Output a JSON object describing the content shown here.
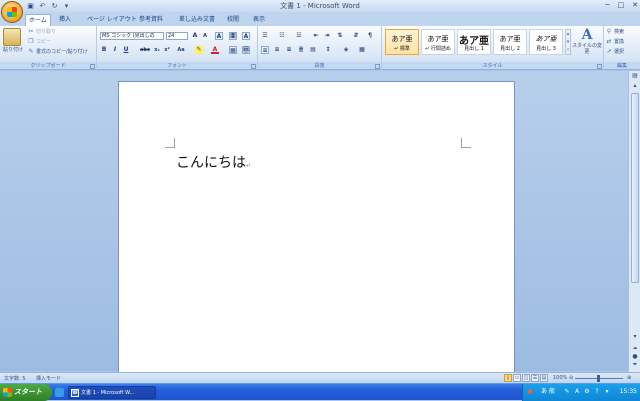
{
  "window": {
    "title": "文書 1 - Microsoft Word",
    "controls": [
      "─",
      "□",
      "✕"
    ]
  },
  "qat": {
    "icons": [
      "save-icon",
      "undo-icon",
      "redo-icon",
      "customize-icon"
    ]
  },
  "tabs": [
    "ホーム",
    "挿入",
    "ページ レイアウト",
    "参考資料",
    "差し込み文書",
    "校閲",
    "表示"
  ],
  "active_tab": "ホーム",
  "clipboard": {
    "paste": "貼り付け",
    "cut": "切り取り",
    "copy": "コピー",
    "format_painter": "書式のコピー/貼り付け",
    "label": "クリップボード"
  },
  "font": {
    "name": "MS ゴシック (見出しの",
    "size": "24",
    "label": "フォント",
    "buttons": {
      "bold": "B",
      "italic": "I",
      "underline": "U",
      "strike": "abc",
      "subscript": "x₂",
      "superscript": "x²",
      "case": "Aa",
      "grow": "A",
      "shrink": "A",
      "clear": "A",
      "phonetic": "亜",
      "border": "A"
    }
  },
  "paragraph": {
    "label": "段落"
  },
  "styles": {
    "label": "スタイル",
    "items": [
      {
        "sample": "あア亜",
        "name": "↵ 標準",
        "selected": true
      },
      {
        "sample": "あア亜",
        "name": "↵ 行間詰め",
        "selected": false
      },
      {
        "sample": "あア亜",
        "name": "見出し 1",
        "selected": false
      },
      {
        "sample": "あア亜",
        "name": "見出し 2",
        "selected": false
      },
      {
        "sample": "あア亜",
        "name": "見出し 3",
        "selected": false
      }
    ],
    "change_label": "スタイルの変更"
  },
  "editing": {
    "label": "編集",
    "find": "検索",
    "replace": "置換",
    "select": "選択"
  },
  "document": {
    "text": "こんにちは",
    "pilcrow": "↵"
  },
  "status": {
    "word_count": "文字数: 5",
    "mode": "挿入モード",
    "zoom": "100%"
  },
  "taskbar": {
    "start": "スタート",
    "task": "文書 1 - Microsoft W...",
    "clock": "15:35",
    "ime": "あ 般"
  },
  "colors": {
    "accent": "#15428b",
    "ribbon_bg": "#dbe7f6",
    "taskbar": "#245edb",
    "start": "#3a8f32"
  }
}
